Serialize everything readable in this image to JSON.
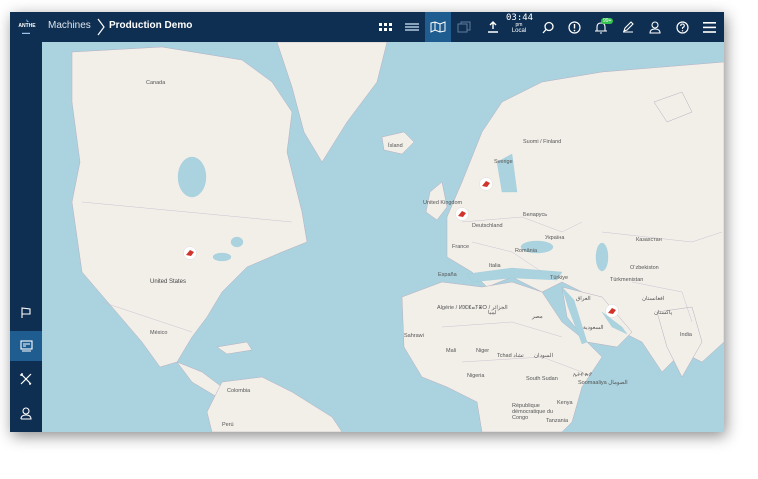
{
  "header": {
    "logo_text": "ANTHE",
    "breadcrumb_root": "Machines",
    "breadcrumb_current": "Production Demo",
    "clock_time": "03:44",
    "clock_ampm": "pm",
    "clock_zone": "Local",
    "notification_badge": "99+"
  },
  "map_labels": {
    "canada": "Canada",
    "united_states": "United States",
    "mexico": "México",
    "colombia": "Colombia",
    "peru": "Perú",
    "iceland": "Ísland",
    "sverige": "Sverige",
    "suomi": "Suomi / Finland",
    "united_kingdom": "United Kingdom",
    "deutschland": "Deutschland",
    "belarus": "Беларусь",
    "ukraine": "Україна",
    "france": "France",
    "romania": "România",
    "espana": "España",
    "italia": "Italia",
    "turkiye": "Türkiye",
    "kazakhstan": "Казахстан",
    "uzbekistan": "O‘zbekiston",
    "turkmenistan": "Türkmenistan",
    "afghanistan": "افغانستان",
    "pakistan": "پاکستان",
    "india": "India",
    "iraq": "العراق",
    "saudi": "السعودية",
    "algeria": "Algérie / ⵍⵣⵣⴰⵢⴻⵔ / الجزائر",
    "libya": "ليبيا",
    "egypt": "مصر",
    "mali": "Mali",
    "niger": "Niger",
    "tchad": "Tchad تشاد",
    "sudan": "السودان",
    "nigeria": "Nigeria",
    "south_sudan": "South Sudan",
    "ethiopia": "ኢትዮጵያ",
    "somalia": "Soomaaliya الصومال",
    "kenya": "Kenya",
    "tanzania": "Tanzania",
    "drc": "République démocratique du Congo",
    "sahara": "Sahrawi"
  }
}
